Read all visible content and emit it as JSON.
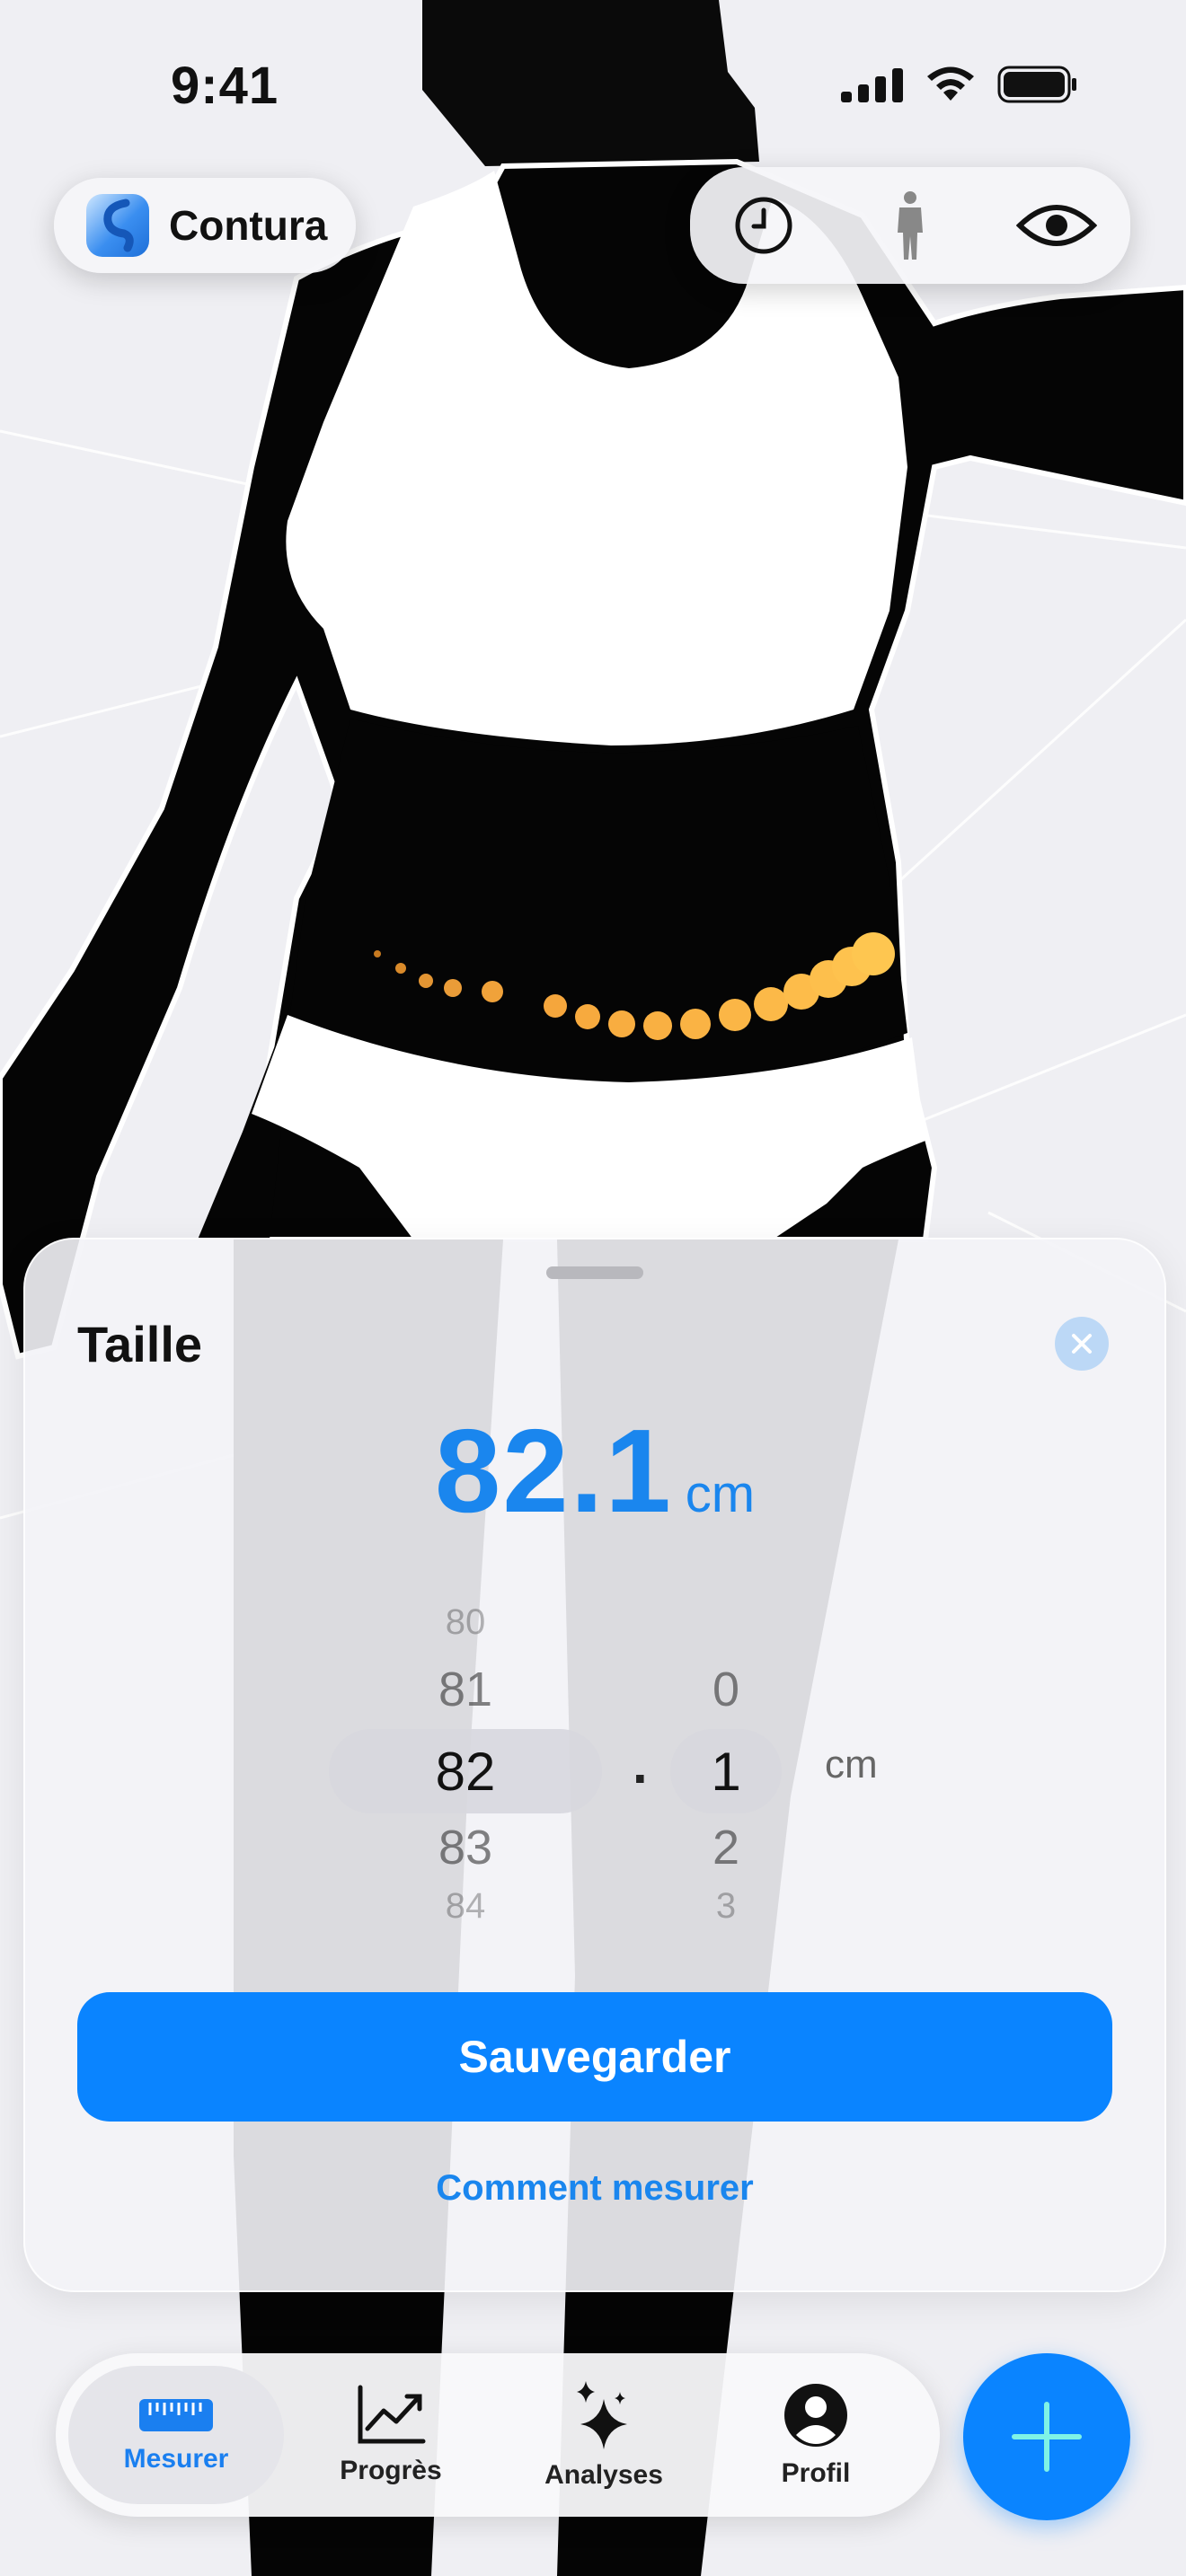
{
  "status_bar": {
    "time": "9:41"
  },
  "app": {
    "name": "Contura"
  },
  "top_controls": {
    "icons": [
      "clock-icon",
      "body-figure-icon",
      "eye-icon"
    ]
  },
  "sheet": {
    "title": "Taille",
    "value": "82.1",
    "unit": "cm",
    "picker": {
      "integer_options": [
        "80",
        "81",
        "82",
        "83",
        "84"
      ],
      "integer_selected": "82",
      "separator": ".",
      "decimal_options": [
        "",
        "0",
        "1",
        "2",
        "3"
      ],
      "decimal_selected": "1",
      "unit": "cm"
    },
    "save_label": "Sauvegarder",
    "howto_label": "Comment mesurer"
  },
  "tabbar": {
    "tabs": [
      {
        "label": "Mesurer",
        "icon": "ruler-icon",
        "active": true
      },
      {
        "label": "Progrès",
        "icon": "chart-line-icon",
        "active": false
      },
      {
        "label": "Analyses",
        "icon": "sparkles-icon",
        "active": false
      },
      {
        "label": "Profil",
        "icon": "person-circle-icon",
        "active": false
      }
    ]
  },
  "fab": {
    "icon": "plus-icon"
  },
  "colors": {
    "accent": "#0A84FF",
    "measure_dots": "#F7A93A",
    "background": "#EEEEF2"
  }
}
